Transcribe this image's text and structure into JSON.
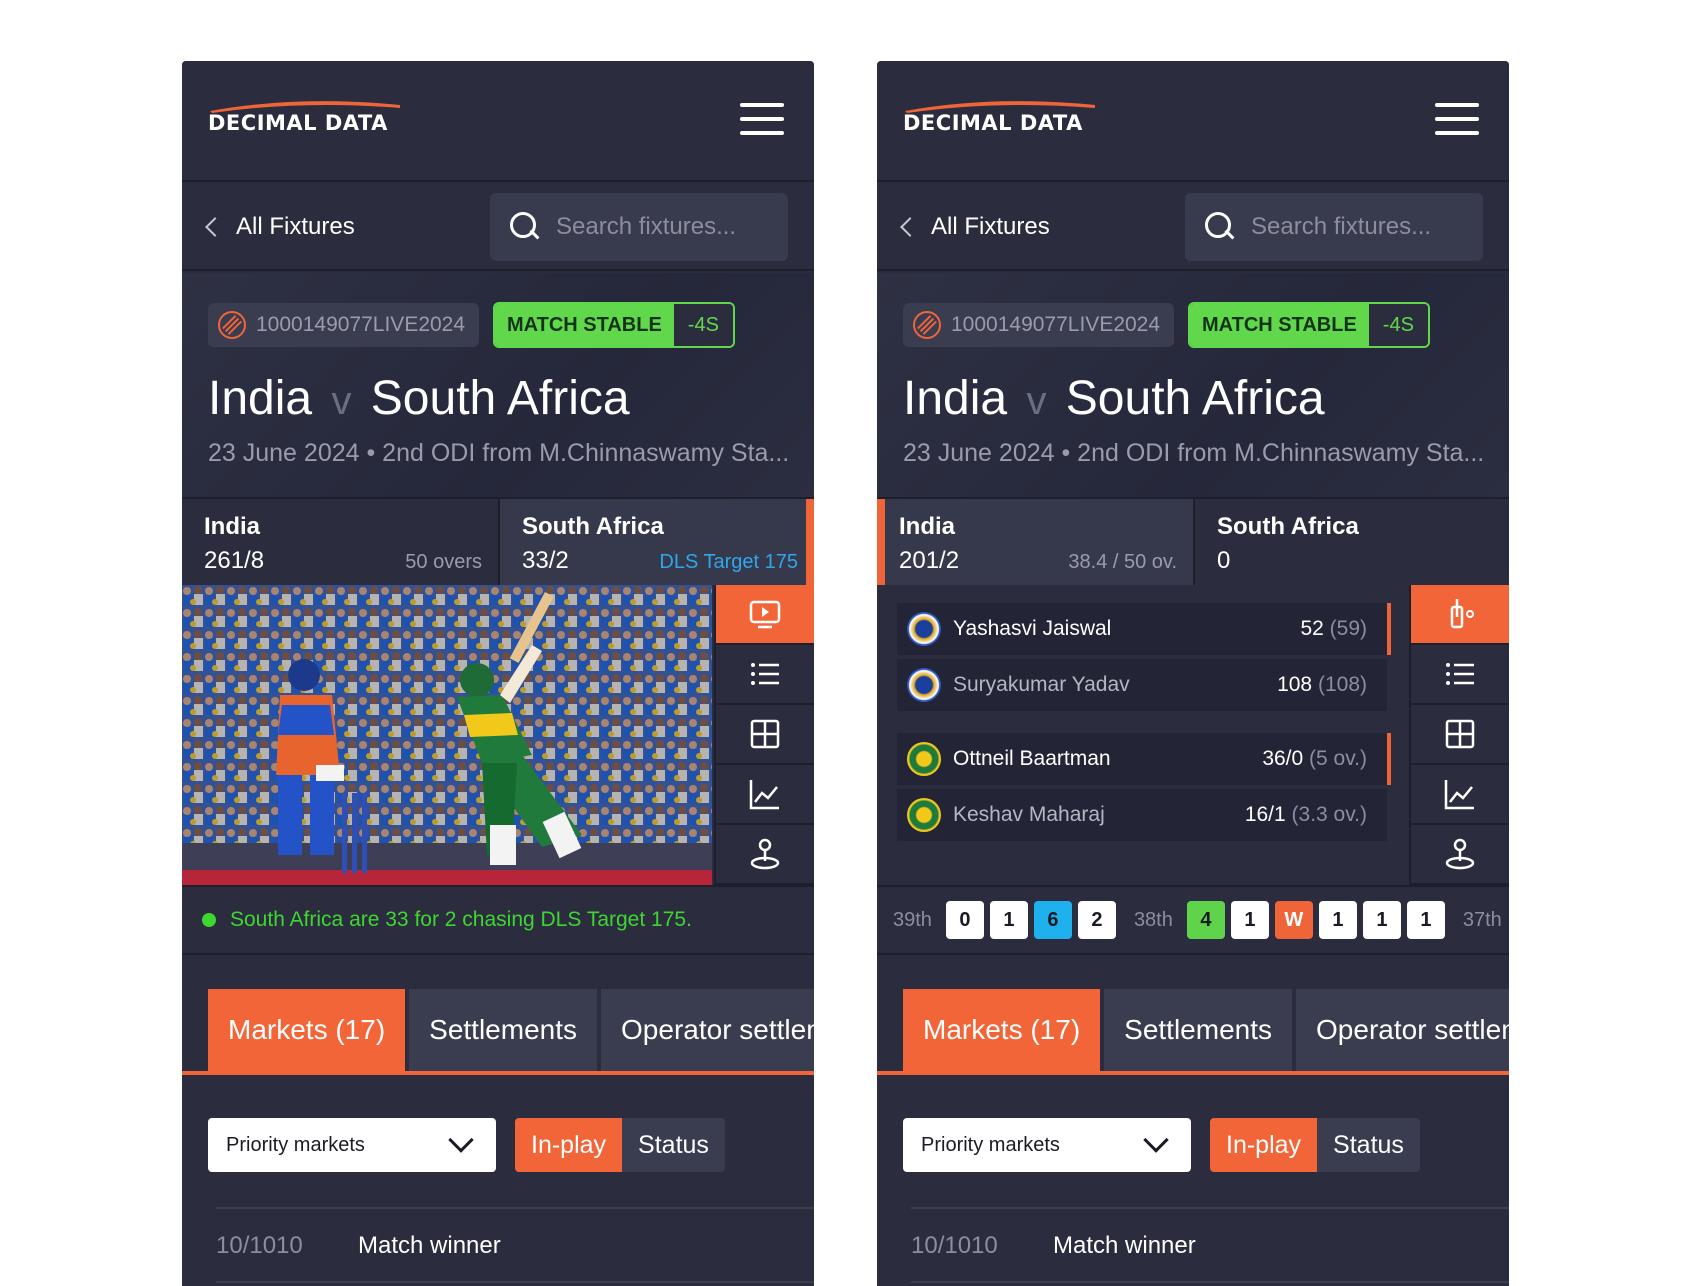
{
  "brand": {
    "name": "DECIMAL DATA",
    "accent": "#f26538"
  },
  "nav": {
    "back_label": "All Fixtures",
    "search_placeholder": "Search fixtures..."
  },
  "fixture": {
    "id": "1000149077LIVE2024",
    "status": "MATCH STABLE",
    "status_delay": "-4S",
    "home": "India",
    "separator": "v",
    "away": "South Africa",
    "subtitle": "23 June 2024  •  2nd ODI from M.Chinnaswamy Sta..."
  },
  "left": {
    "team1": {
      "name": "India",
      "score": "261/8",
      "extra": "50 overs"
    },
    "team2": {
      "name": "South Africa",
      "score": "33/2",
      "extra": "DLS Target 175"
    },
    "live_text": "South Africa are 33 for 2 chasing DLS Target 175."
  },
  "right": {
    "team1": {
      "name": "India",
      "score": "201/2",
      "extra": "38.4 / 50 ov."
    },
    "team2": {
      "name": "South Africa",
      "score": "0"
    },
    "batters": [
      {
        "name": "Yashasvi Jaiswal",
        "runs": "52",
        "balls": "(59)"
      },
      {
        "name": "Suryakumar Yadav",
        "runs": "108",
        "balls": "(108)"
      }
    ],
    "bowlers": [
      {
        "name": "Ottneil Baartman",
        "figures": "36/0",
        "overs": "(5 ov.)"
      },
      {
        "name": "Keshav Maharaj",
        "figures": "16/1",
        "overs": "(3.3 ov.)"
      }
    ],
    "overs": [
      {
        "label": "39th",
        "balls": [
          "0",
          "1",
          "6",
          "2"
        ]
      },
      {
        "label": "38th",
        "balls": [
          "4",
          "1",
          "W",
          "1",
          "1",
          "1"
        ]
      },
      {
        "label": "37th",
        "balls": []
      }
    ]
  },
  "tabs": [
    "Markets (17)",
    "Settlements",
    "Operator settlements"
  ],
  "filters": {
    "select_value": "Priority markets",
    "seg_inplay": "In-play",
    "seg_status": "Status"
  },
  "markets": [
    {
      "odds": "10/1010",
      "name": "Match winner"
    }
  ],
  "icons": {
    "tools_left": [
      "video-icon",
      "list-icon",
      "grid-icon",
      "chart-icon",
      "map-pin-icon"
    ],
    "tools_right": [
      "pitch-icon",
      "list-icon",
      "grid-icon",
      "chart-icon",
      "map-pin-icon"
    ]
  },
  "colors": {
    "live_green": "#3ed631",
    "status_green": "#61d84c",
    "dls_blue": "#2fa6ea",
    "bg": "#2b2d3e"
  }
}
